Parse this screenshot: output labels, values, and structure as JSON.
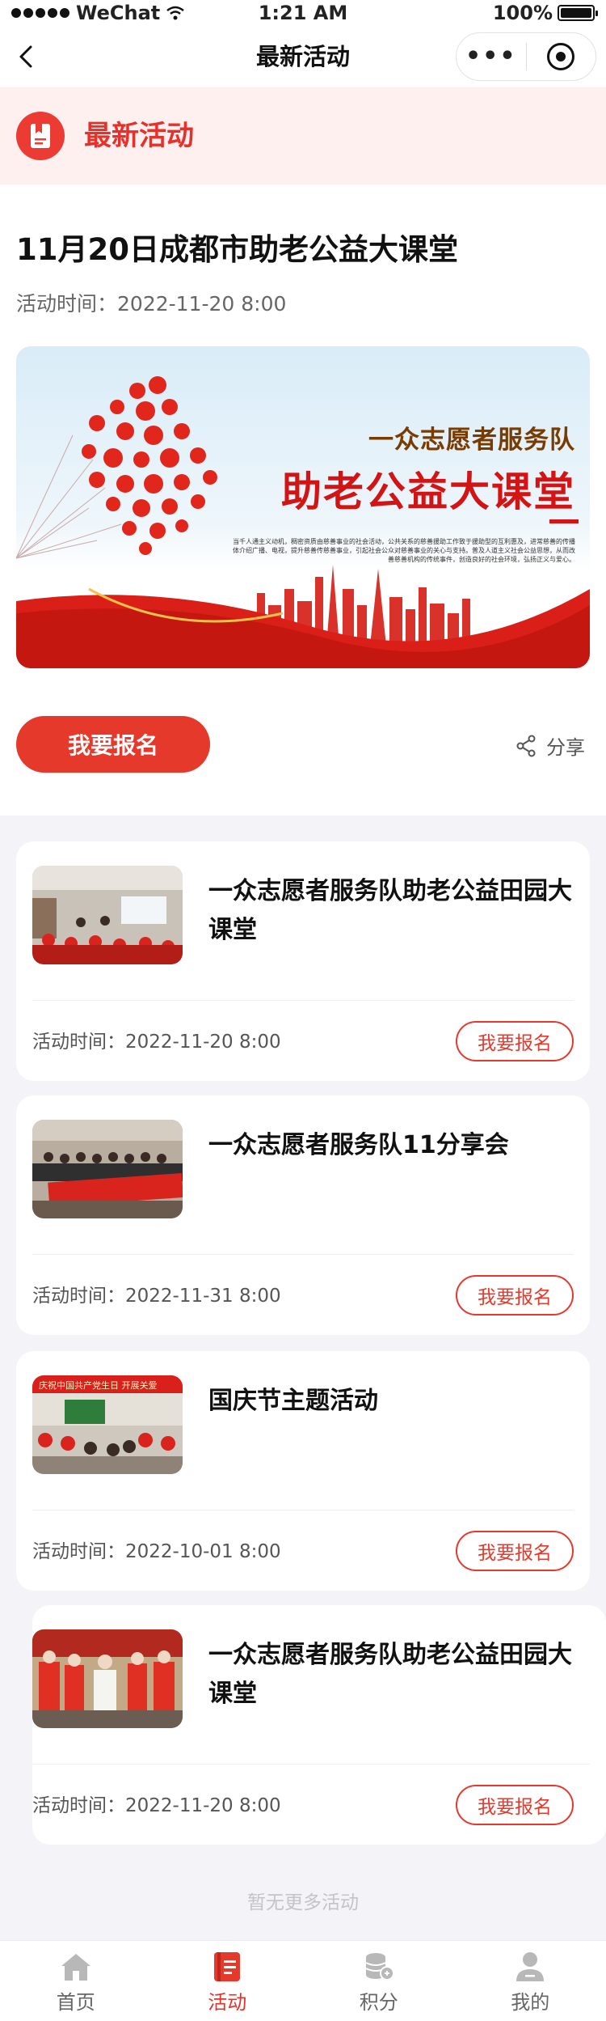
{
  "status_bar": {
    "carrier": "WeChat",
    "time": "1:21 AM",
    "battery": "100%"
  },
  "nav": {
    "title": "最新活动"
  },
  "section": {
    "title": "最新活动"
  },
  "featured": {
    "title": "11月20日成都市助老公益大课堂",
    "time_label": "活动时间：",
    "time_value": "2022-11-20  8:00",
    "banner": {
      "slogan": "一众志愿者服务队",
      "heading": "助老公益大课堂",
      "body": "当千人通主义动机，稠密资质由慈善事业的社会活动，公共关系的慈善援助工作致于援助型的互利惠及，进常慈善的传播体介绍广播、电视，提升慈善传慈善事业，引起社会公众对慈善事业的关心与支持。普及人道主义社会公益思想，从而改善慈善机构的传统事件，创造良好的社会环境，弘扬正义与爱心。"
    },
    "signup_label": "我要报名",
    "share_label": "分享"
  },
  "activities": [
    {
      "title": "一众志愿者服务队助老公益田园大课堂",
      "time_label": "活动时间：",
      "time_value": "2022-11-20  8:00",
      "button": "我要报名"
    },
    {
      "title": "一众志愿者服务队11分享会",
      "time_label": "活动时间：",
      "time_value": "2022-11-31  8:00",
      "button": "我要报名"
    },
    {
      "title": "国庆节主题活动",
      "time_label": "活动时间：",
      "time_value": "2022-10-01  8:00",
      "button": "我要报名",
      "photo_banner": "庆祝中国共产党生日  开展关爱"
    },
    {
      "title": "一众志愿者服务队助老公益田园大课堂",
      "time_label": "活动时间：",
      "time_value": "2022-11-20  8:00",
      "button": "我要报名"
    }
  ],
  "no_more": "暂无更多活动",
  "tabbar": [
    {
      "label": "首页",
      "icon": "home-icon"
    },
    {
      "label": "活动",
      "icon": "activity-icon",
      "active": true
    },
    {
      "label": "积分",
      "icon": "points-icon"
    },
    {
      "label": "我的",
      "icon": "user-icon"
    }
  ],
  "colors": {
    "accent": "#e5392c",
    "header_bg": "#fdf0ee",
    "page_bg": "#f4f4f8"
  }
}
